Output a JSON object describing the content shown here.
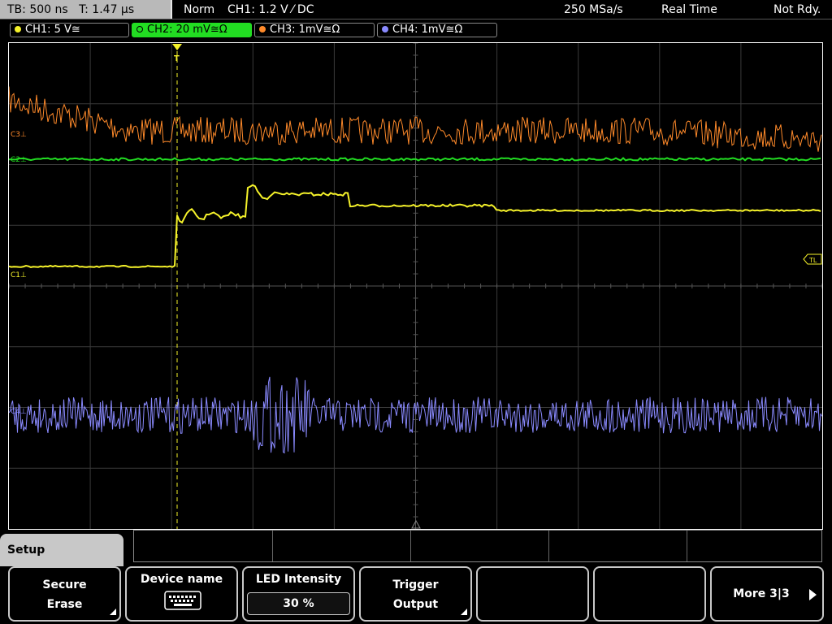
{
  "status": {
    "timebase": "TB: 500 ns",
    "trigger_time": "T: 1.47 µs",
    "mode": "Norm",
    "trigger_info": "CH1: 1.2 V ⁄ DC",
    "sample_rate": "250 MSa/s",
    "acq_mode": "Real Time",
    "ready_state": "Not Rdy."
  },
  "channels": [
    {
      "label": "CH1: 5 V≅",
      "color": "#f5f22a"
    },
    {
      "label": "CH2: 20 mV≅Ω",
      "color": "#22dd22"
    },
    {
      "label": "CH3: 1mV≅Ω",
      "color": "#ff8a2a"
    },
    {
      "label": "CH4: 1mV≅Ω",
      "color": "#8a8aff"
    }
  ],
  "markers": {
    "c3": "C3⊥",
    "c2": "C2⊥",
    "c1": "C1⊥",
    "c4": "C4⊥",
    "trigger_level": "TL",
    "trigger_pos": "T"
  },
  "menu": {
    "title": "Setup",
    "softkeys": [
      {
        "line1": "Secure",
        "line2": "Erase"
      },
      {
        "line1": "Device name",
        "icon": "keyboard-icon"
      },
      {
        "line1": "LED Intensity",
        "value": "30 %"
      },
      {
        "line1": "Trigger",
        "line2": "Output"
      },
      {
        "line1": ""
      },
      {
        "line1": ""
      },
      {
        "line1": "More 3|3"
      }
    ]
  }
}
